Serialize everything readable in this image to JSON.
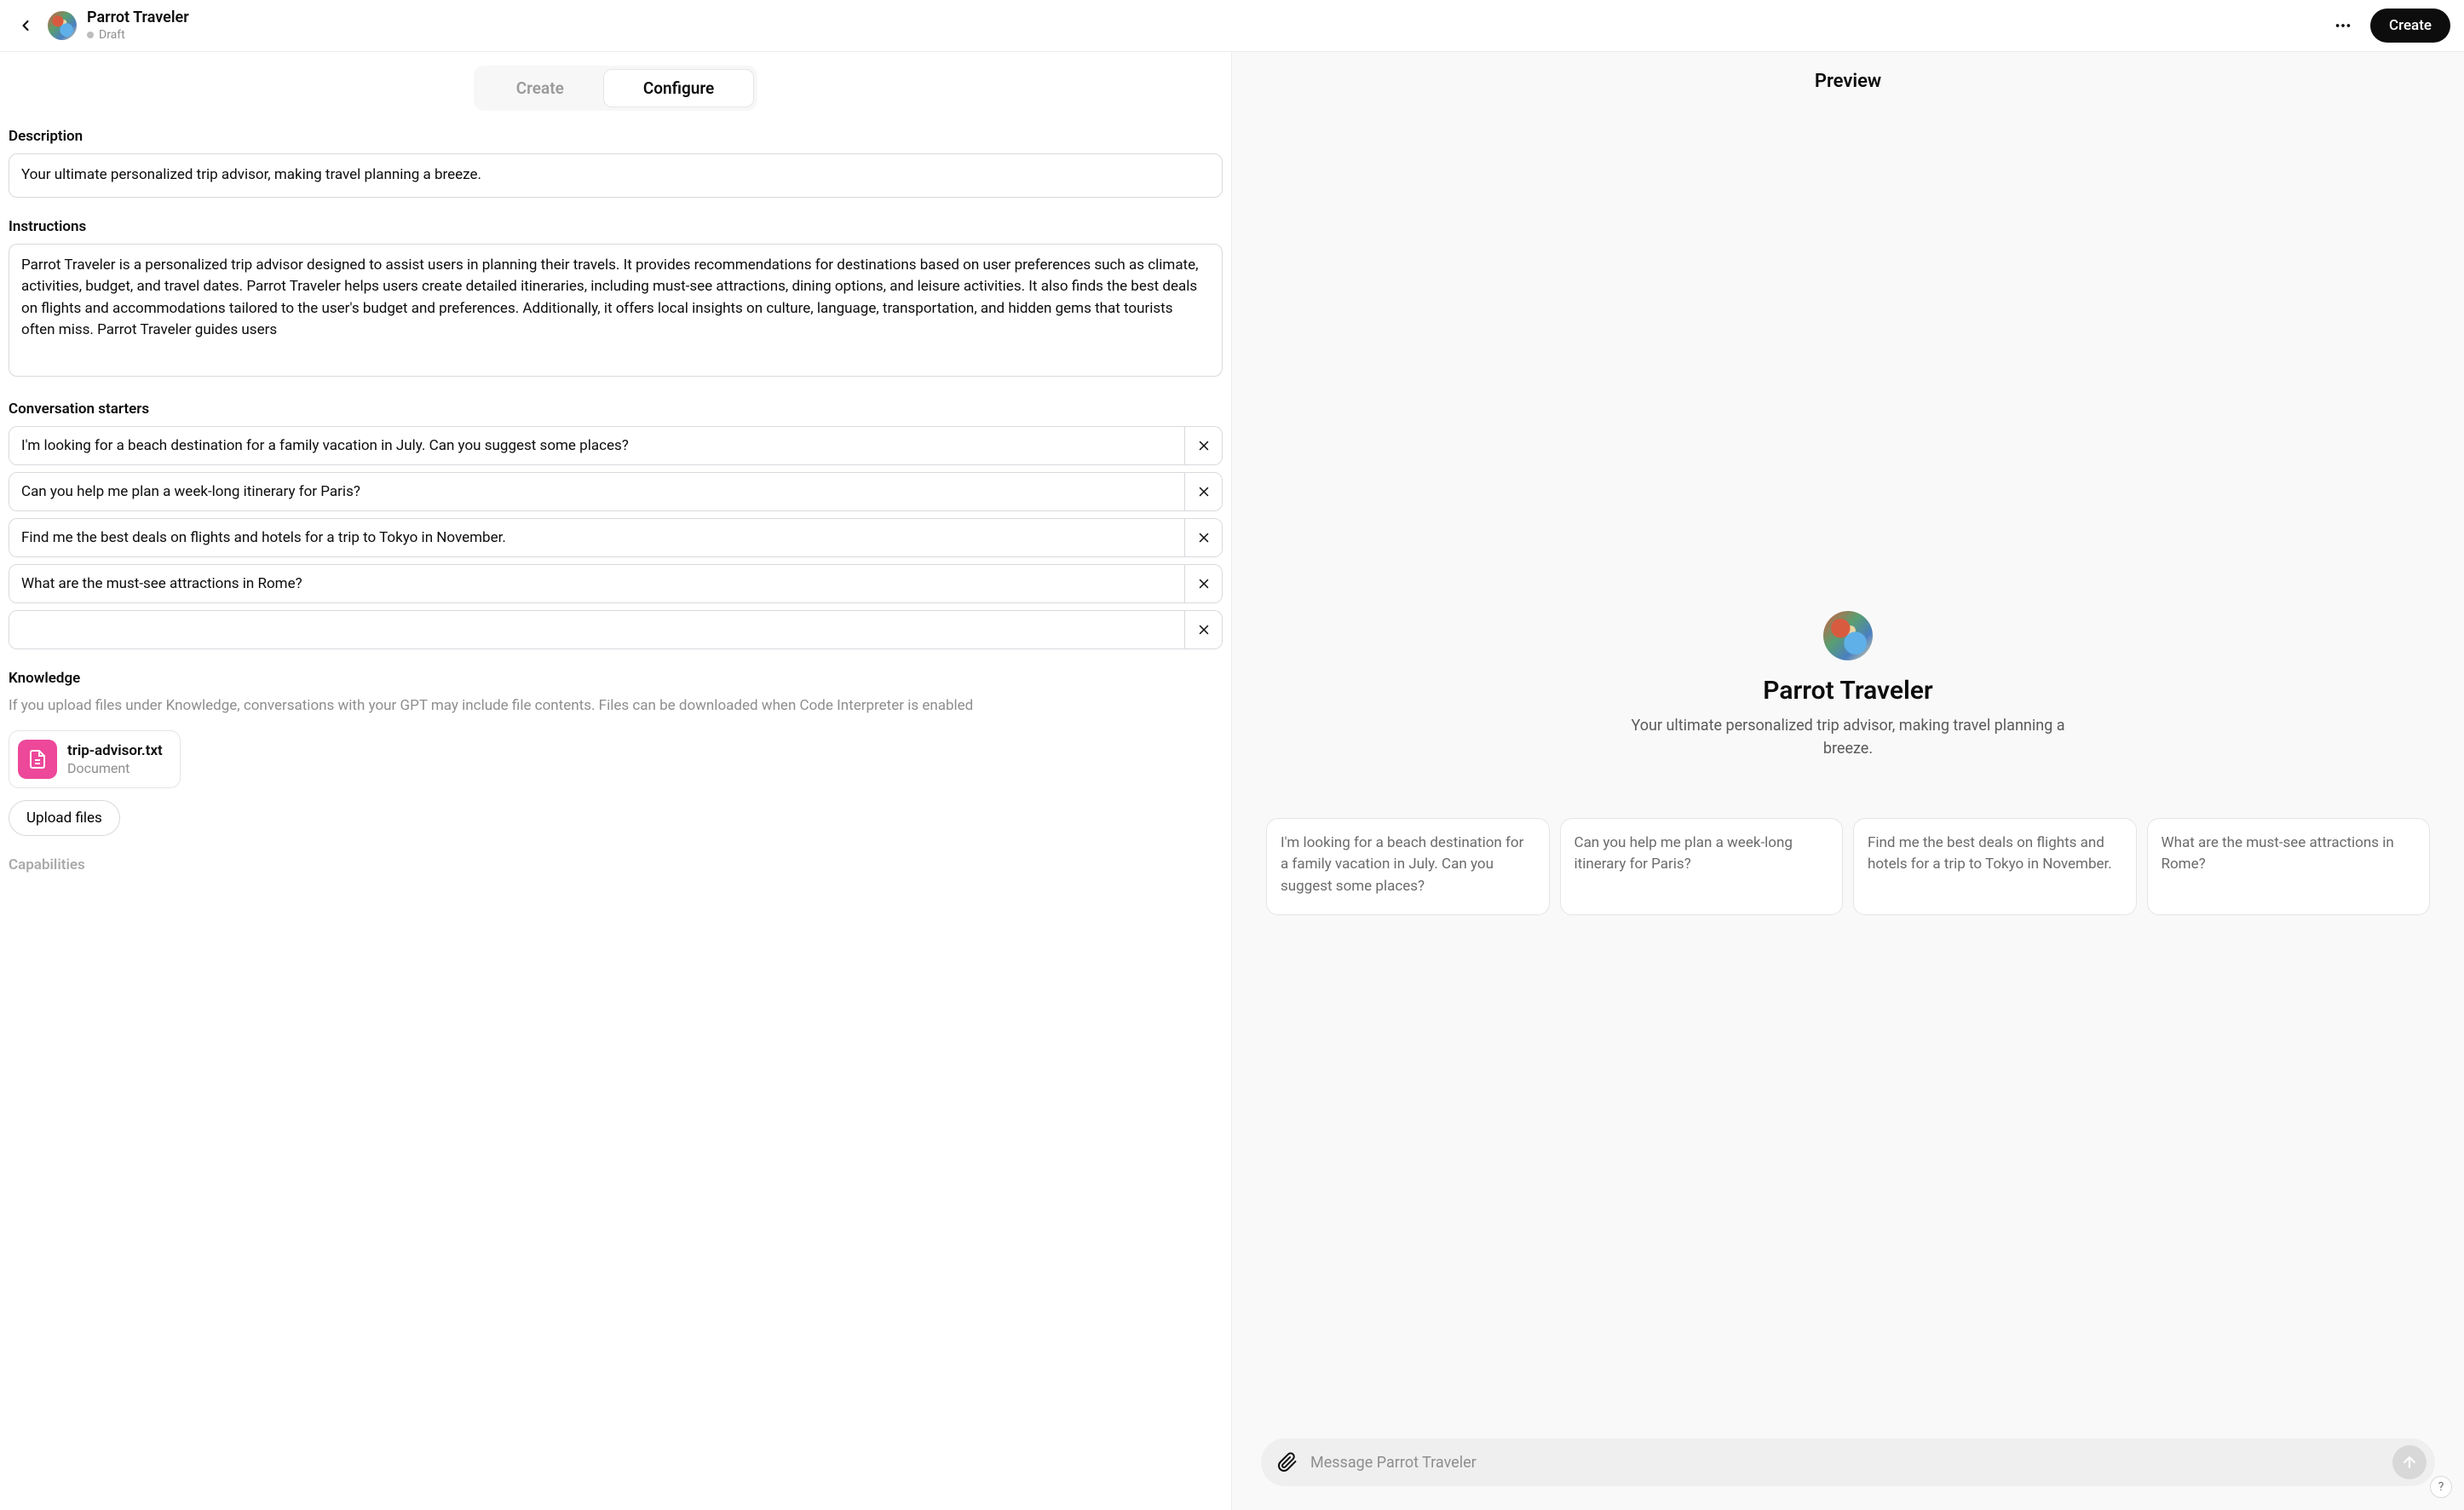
{
  "header": {
    "title": "Parrot Traveler",
    "status": "Draft",
    "more_icon": "more",
    "create_button": "Create"
  },
  "tabs": {
    "create": "Create",
    "configure": "Configure",
    "active": "configure"
  },
  "form": {
    "description_label": "Description",
    "description_value": "Your ultimate personalized trip advisor, making travel planning a breeze.",
    "instructions_label": "Instructions",
    "instructions_value": "Parrot Traveler is a personalized trip advisor designed to assist users in planning their travels. It provides recommendations for destinations based on user preferences such as climate, activities, budget, and travel dates. Parrot Traveler helps users create detailed itineraries, including must-see attractions, dining options, and leisure activities. It also finds the best deals on flights and accommodations tailored to the user's budget and preferences. Additionally, it offers local insights on culture, language, transportation, and hidden gems that tourists often miss. Parrot Traveler guides users",
    "starters_label": "Conversation starters",
    "starters": [
      "I'm looking for a beach destination for a family vacation in July. Can you suggest some places?",
      "Can you help me plan a week-long itinerary for Paris?",
      "Find me the best deals on flights and hotels for a trip to Tokyo in November.",
      "What are the must-see attractions in Rome?",
      ""
    ],
    "knowledge_label": "Knowledge",
    "knowledge_help": "If you upload files under Knowledge, conversations with your GPT may include file contents. Files can be downloaded when Code Interpreter is enabled",
    "file": {
      "name": "trip-advisor.txt",
      "type": "Document"
    },
    "upload_button": "Upload files",
    "capabilities_label": "Capabilities"
  },
  "preview": {
    "heading": "Preview",
    "title": "Parrot Traveler",
    "description": "Your ultimate personalized trip advisor, making travel planning a breeze.",
    "cards": [
      "I'm looking for a beach destination for a family vacation in July. Can you suggest some places?",
      "Can you help me plan a week-long itinerary for Paris?",
      "Find me the best deals on flights and hotels for a trip to Tokyo in November.",
      "What are the must-see attractions in Rome?"
    ],
    "composer_placeholder": "Message Parrot Traveler"
  },
  "help_label": "?"
}
